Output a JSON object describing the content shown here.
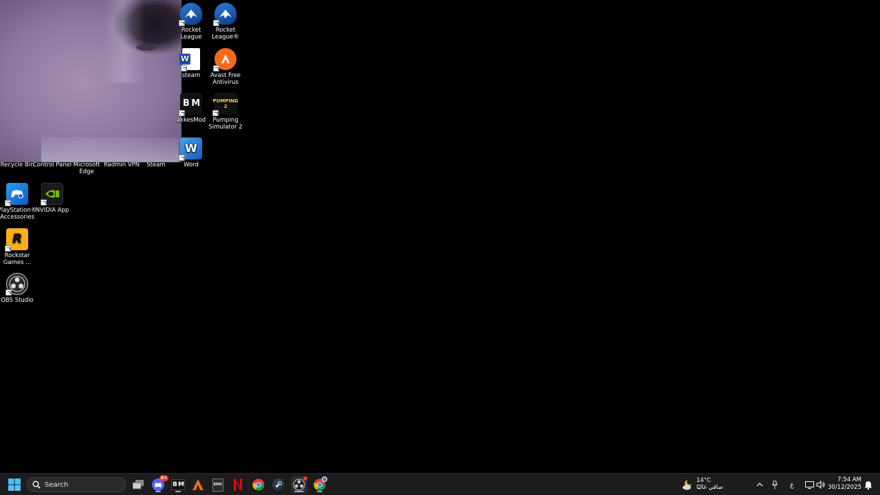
{
  "desktop": {
    "icons_row1": [
      {
        "label": "Recycle Bin",
        "icon": "recycle-bin-icon"
      },
      {
        "label": "Control Panel",
        "icon": "control-panel-icon"
      },
      {
        "label": "Microsoft\nEdge",
        "icon": "edge-icon"
      },
      {
        "label": "Radmin VPN",
        "icon": "radmin-vpn-icon"
      },
      {
        "label": "Steam",
        "icon": "steam-icon"
      }
    ],
    "icons_col6": [
      {
        "label": "Rocket\nLeague",
        "icon": "rocket-league-icon"
      },
      {
        "label": "steam",
        "icon": "word-doc-icon",
        "glyph": "W"
      },
      {
        "label": "akkesMod",
        "icon": "bakkesmod-icon",
        "glyph": "B M"
      },
      {
        "label": "Word",
        "icon": "word-icon",
        "glyph": "W"
      }
    ],
    "icons_col7": [
      {
        "label": "Rocket\nLeague®",
        "icon": "rocket-league-icon"
      },
      {
        "label": "Avast Free\nAntivirus",
        "icon": "avast-icon"
      },
      {
        "label": "Pumping\nSimulator 2",
        "icon": "pumping-simulator-icon",
        "glyph": "PUMPING 2"
      }
    ],
    "icons_col1": [
      {
        "label": "PlayStation®\nAccessories",
        "icon": "playstation-accessories-icon"
      },
      {
        "label": "Rockstar\nGames ...",
        "icon": "rockstar-games-icon",
        "glyph": "R"
      },
      {
        "label": "OBS Studio",
        "icon": "obs-studio-icon"
      }
    ],
    "icons_col2": [
      {
        "label": "NVIDIA App",
        "icon": "nvidia-app-icon"
      }
    ]
  },
  "taskbar": {
    "search_placeholder": "Search",
    "epic_glyph": "EPIC",
    "bm_glyph": "B M",
    "discord_badge": "9+",
    "weather_temp": "14°C",
    "weather_desc": "صافي غالبًا",
    "language": "ع",
    "time": "7:54 AM",
    "date": "30/12/2025"
  },
  "colors": {
    "taskbar_bg": "#1c1c1c",
    "accent": "#0078d4",
    "steam_blue": "#1b3a6b",
    "word_blue": "#185abd",
    "avast_orange": "#f26b1d",
    "nvidia_green": "#76b900"
  }
}
